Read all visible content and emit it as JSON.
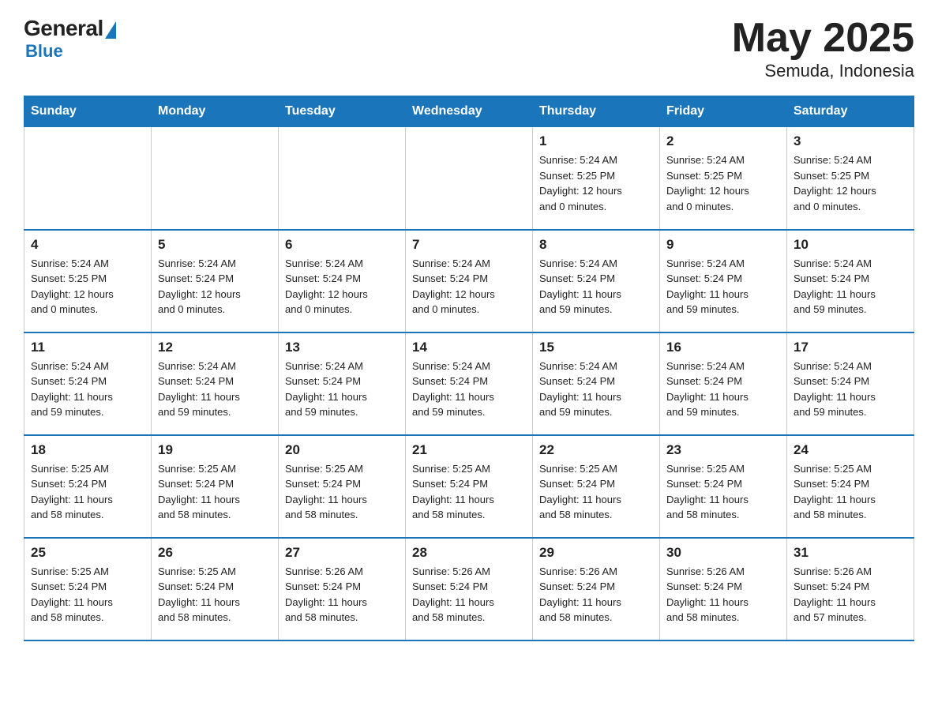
{
  "header": {
    "logo_general": "General",
    "logo_blue": "Blue",
    "title": "May 2025",
    "subtitle": "Semuda, Indonesia"
  },
  "days_of_week": [
    "Sunday",
    "Monday",
    "Tuesday",
    "Wednesday",
    "Thursday",
    "Friday",
    "Saturday"
  ],
  "weeks": [
    {
      "days": [
        {
          "number": "",
          "info": ""
        },
        {
          "number": "",
          "info": ""
        },
        {
          "number": "",
          "info": ""
        },
        {
          "number": "",
          "info": ""
        },
        {
          "number": "1",
          "info": "Sunrise: 5:24 AM\nSunset: 5:25 PM\nDaylight: 12 hours\nand 0 minutes."
        },
        {
          "number": "2",
          "info": "Sunrise: 5:24 AM\nSunset: 5:25 PM\nDaylight: 12 hours\nand 0 minutes."
        },
        {
          "number": "3",
          "info": "Sunrise: 5:24 AM\nSunset: 5:25 PM\nDaylight: 12 hours\nand 0 minutes."
        }
      ]
    },
    {
      "days": [
        {
          "number": "4",
          "info": "Sunrise: 5:24 AM\nSunset: 5:25 PM\nDaylight: 12 hours\nand 0 minutes."
        },
        {
          "number": "5",
          "info": "Sunrise: 5:24 AM\nSunset: 5:24 PM\nDaylight: 12 hours\nand 0 minutes."
        },
        {
          "number": "6",
          "info": "Sunrise: 5:24 AM\nSunset: 5:24 PM\nDaylight: 12 hours\nand 0 minutes."
        },
        {
          "number": "7",
          "info": "Sunrise: 5:24 AM\nSunset: 5:24 PM\nDaylight: 12 hours\nand 0 minutes."
        },
        {
          "number": "8",
          "info": "Sunrise: 5:24 AM\nSunset: 5:24 PM\nDaylight: 11 hours\nand 59 minutes."
        },
        {
          "number": "9",
          "info": "Sunrise: 5:24 AM\nSunset: 5:24 PM\nDaylight: 11 hours\nand 59 minutes."
        },
        {
          "number": "10",
          "info": "Sunrise: 5:24 AM\nSunset: 5:24 PM\nDaylight: 11 hours\nand 59 minutes."
        }
      ]
    },
    {
      "days": [
        {
          "number": "11",
          "info": "Sunrise: 5:24 AM\nSunset: 5:24 PM\nDaylight: 11 hours\nand 59 minutes."
        },
        {
          "number": "12",
          "info": "Sunrise: 5:24 AM\nSunset: 5:24 PM\nDaylight: 11 hours\nand 59 minutes."
        },
        {
          "number": "13",
          "info": "Sunrise: 5:24 AM\nSunset: 5:24 PM\nDaylight: 11 hours\nand 59 minutes."
        },
        {
          "number": "14",
          "info": "Sunrise: 5:24 AM\nSunset: 5:24 PM\nDaylight: 11 hours\nand 59 minutes."
        },
        {
          "number": "15",
          "info": "Sunrise: 5:24 AM\nSunset: 5:24 PM\nDaylight: 11 hours\nand 59 minutes."
        },
        {
          "number": "16",
          "info": "Sunrise: 5:24 AM\nSunset: 5:24 PM\nDaylight: 11 hours\nand 59 minutes."
        },
        {
          "number": "17",
          "info": "Sunrise: 5:24 AM\nSunset: 5:24 PM\nDaylight: 11 hours\nand 59 minutes."
        }
      ]
    },
    {
      "days": [
        {
          "number": "18",
          "info": "Sunrise: 5:25 AM\nSunset: 5:24 PM\nDaylight: 11 hours\nand 58 minutes."
        },
        {
          "number": "19",
          "info": "Sunrise: 5:25 AM\nSunset: 5:24 PM\nDaylight: 11 hours\nand 58 minutes."
        },
        {
          "number": "20",
          "info": "Sunrise: 5:25 AM\nSunset: 5:24 PM\nDaylight: 11 hours\nand 58 minutes."
        },
        {
          "number": "21",
          "info": "Sunrise: 5:25 AM\nSunset: 5:24 PM\nDaylight: 11 hours\nand 58 minutes."
        },
        {
          "number": "22",
          "info": "Sunrise: 5:25 AM\nSunset: 5:24 PM\nDaylight: 11 hours\nand 58 minutes."
        },
        {
          "number": "23",
          "info": "Sunrise: 5:25 AM\nSunset: 5:24 PM\nDaylight: 11 hours\nand 58 minutes."
        },
        {
          "number": "24",
          "info": "Sunrise: 5:25 AM\nSunset: 5:24 PM\nDaylight: 11 hours\nand 58 minutes."
        }
      ]
    },
    {
      "days": [
        {
          "number": "25",
          "info": "Sunrise: 5:25 AM\nSunset: 5:24 PM\nDaylight: 11 hours\nand 58 minutes."
        },
        {
          "number": "26",
          "info": "Sunrise: 5:25 AM\nSunset: 5:24 PM\nDaylight: 11 hours\nand 58 minutes."
        },
        {
          "number": "27",
          "info": "Sunrise: 5:26 AM\nSunset: 5:24 PM\nDaylight: 11 hours\nand 58 minutes."
        },
        {
          "number": "28",
          "info": "Sunrise: 5:26 AM\nSunset: 5:24 PM\nDaylight: 11 hours\nand 58 minutes."
        },
        {
          "number": "29",
          "info": "Sunrise: 5:26 AM\nSunset: 5:24 PM\nDaylight: 11 hours\nand 58 minutes."
        },
        {
          "number": "30",
          "info": "Sunrise: 5:26 AM\nSunset: 5:24 PM\nDaylight: 11 hours\nand 58 minutes."
        },
        {
          "number": "31",
          "info": "Sunrise: 5:26 AM\nSunset: 5:24 PM\nDaylight: 11 hours\nand 57 minutes."
        }
      ]
    }
  ]
}
